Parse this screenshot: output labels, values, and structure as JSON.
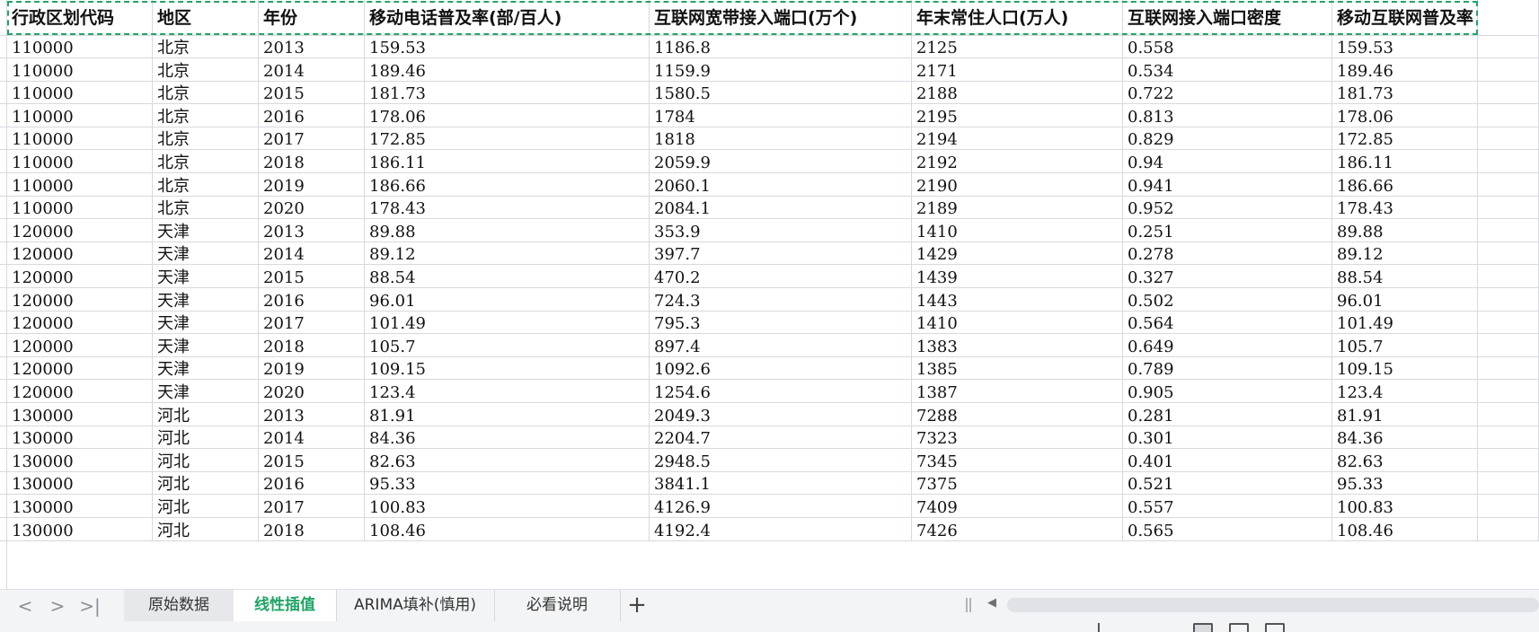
{
  "columns": [
    "行政区划代码",
    "地区",
    "年份",
    "移动电话普及率(部/百人)",
    "互联网宽带接入端口(万个)",
    "年末常住人口(万人)",
    "互联网接入端口密度",
    "移动互联网普及率"
  ],
  "rows": [
    [
      "110000",
      "北京",
      "2013",
      "159.53",
      "1186.8",
      "2125",
      "0.558",
      "159.53"
    ],
    [
      "110000",
      "北京",
      "2014",
      "189.46",
      "1159.9",
      "2171",
      "0.534",
      "189.46"
    ],
    [
      "110000",
      "北京",
      "2015",
      "181.73",
      "1580.5",
      "2188",
      "0.722",
      "181.73"
    ],
    [
      "110000",
      "北京",
      "2016",
      "178.06",
      "1784",
      "2195",
      "0.813",
      "178.06"
    ],
    [
      "110000",
      "北京",
      "2017",
      "172.85",
      "1818",
      "2194",
      "0.829",
      "172.85"
    ],
    [
      "110000",
      "北京",
      "2018",
      "186.11",
      "2059.9",
      "2192",
      "0.94",
      "186.11"
    ],
    [
      "110000",
      "北京",
      "2019",
      "186.66",
      "2060.1",
      "2190",
      "0.941",
      "186.66"
    ],
    [
      "110000",
      "北京",
      "2020",
      "178.43",
      "2084.1",
      "2189",
      "0.952",
      "178.43"
    ],
    [
      "120000",
      "天津",
      "2013",
      "89.88",
      "353.9",
      "1410",
      "0.251",
      "89.88"
    ],
    [
      "120000",
      "天津",
      "2014",
      "89.12",
      "397.7",
      "1429",
      "0.278",
      "89.12"
    ],
    [
      "120000",
      "天津",
      "2015",
      "88.54",
      "470.2",
      "1439",
      "0.327",
      "88.54"
    ],
    [
      "120000",
      "天津",
      "2016",
      "96.01",
      "724.3",
      "1443",
      "0.502",
      "96.01"
    ],
    [
      "120000",
      "天津",
      "2017",
      "101.49",
      "795.3",
      "1410",
      "0.564",
      "101.49"
    ],
    [
      "120000",
      "天津",
      "2018",
      "105.7",
      "897.4",
      "1383",
      "0.649",
      "105.7"
    ],
    [
      "120000",
      "天津",
      "2019",
      "109.15",
      "1092.6",
      "1385",
      "0.789",
      "109.15"
    ],
    [
      "120000",
      "天津",
      "2020",
      "123.4",
      "1254.6",
      "1387",
      "0.905",
      "123.4"
    ],
    [
      "130000",
      "河北",
      "2013",
      "81.91",
      "2049.3",
      "7288",
      "0.281",
      "81.91"
    ],
    [
      "130000",
      "河北",
      "2014",
      "84.36",
      "2204.7",
      "7323",
      "0.301",
      "84.36"
    ],
    [
      "130000",
      "河北",
      "2015",
      "82.63",
      "2948.5",
      "7345",
      "0.401",
      "82.63"
    ],
    [
      "130000",
      "河北",
      "2016",
      "95.33",
      "3841.1",
      "7375",
      "0.521",
      "95.33"
    ],
    [
      "130000",
      "河北",
      "2017",
      "100.83",
      "4126.9",
      "7409",
      "0.557",
      "100.83"
    ],
    [
      "130000",
      "河北",
      "2018",
      "108.46",
      "4192.4",
      "7426",
      "0.565",
      "108.46"
    ]
  ],
  "sheet_tabs": [
    "原始数据",
    "线性插值",
    "ARIMA填补(慎用)",
    "必看说明"
  ],
  "active_tab": "线性插值",
  "nav": {
    "prev": "<",
    "next": ">",
    "last": ">|",
    "add": "+"
  },
  "colors": {
    "accent": "#1fa463",
    "grid": "#d6d9df",
    "marquee": "#21a366"
  }
}
